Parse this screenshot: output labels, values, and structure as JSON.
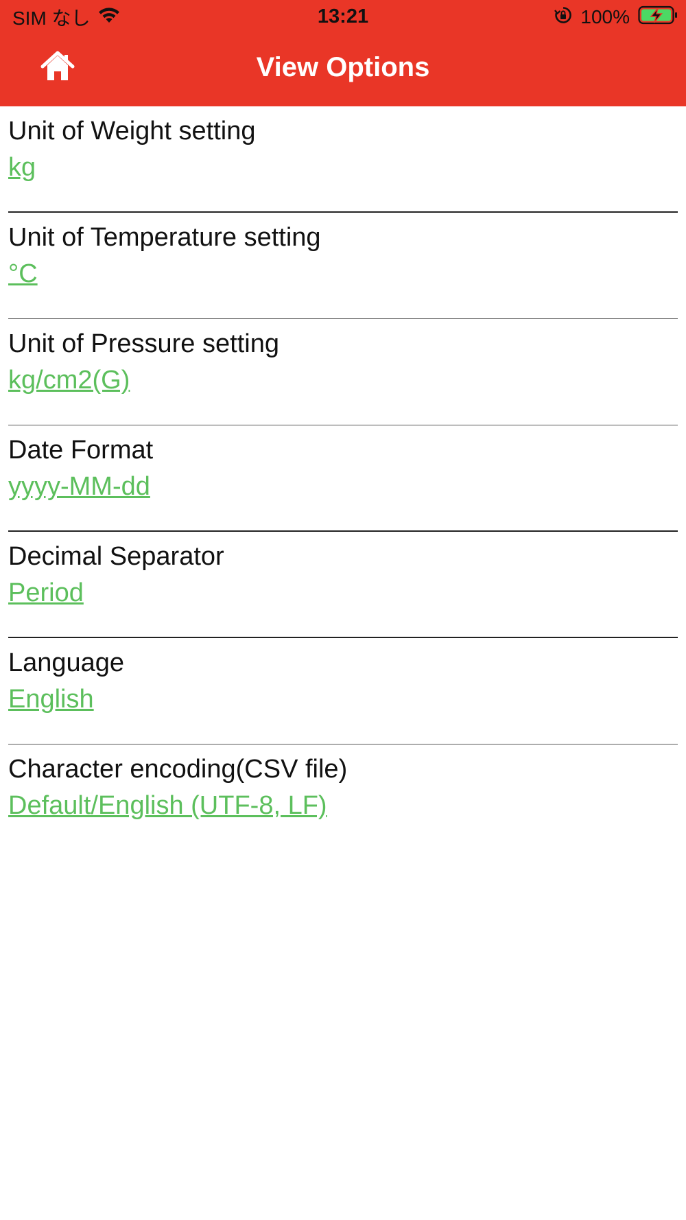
{
  "status_bar": {
    "carrier": "SIM なし",
    "time": "13:21",
    "battery_percent": "100%",
    "icons": [
      "wifi-icon",
      "rotation-lock-icon",
      "battery-charging-icon"
    ]
  },
  "nav": {
    "title": "View Options",
    "home_icon": "home-icon",
    "bar_color": "#e93627"
  },
  "settings": [
    {
      "label": "Unit of Weight setting",
      "value": "kg"
    },
    {
      "label": "Unit of Temperature setting",
      "value": "°C"
    },
    {
      "label": "Unit of Pressure setting",
      "value": "kg/cm2(G)"
    },
    {
      "label": "Date Format",
      "value": "yyyy-MM-dd"
    },
    {
      "label": "Decimal Separator",
      "value": "Period"
    },
    {
      "label": "Language",
      "value": "English"
    },
    {
      "label": "Character encoding(CSV file)",
      "value": "Default/English (UTF-8, LF)"
    }
  ],
  "colors": {
    "accent": "#e93627",
    "link_value": "#5cbf5c",
    "battery_fill": "#4cd964"
  }
}
